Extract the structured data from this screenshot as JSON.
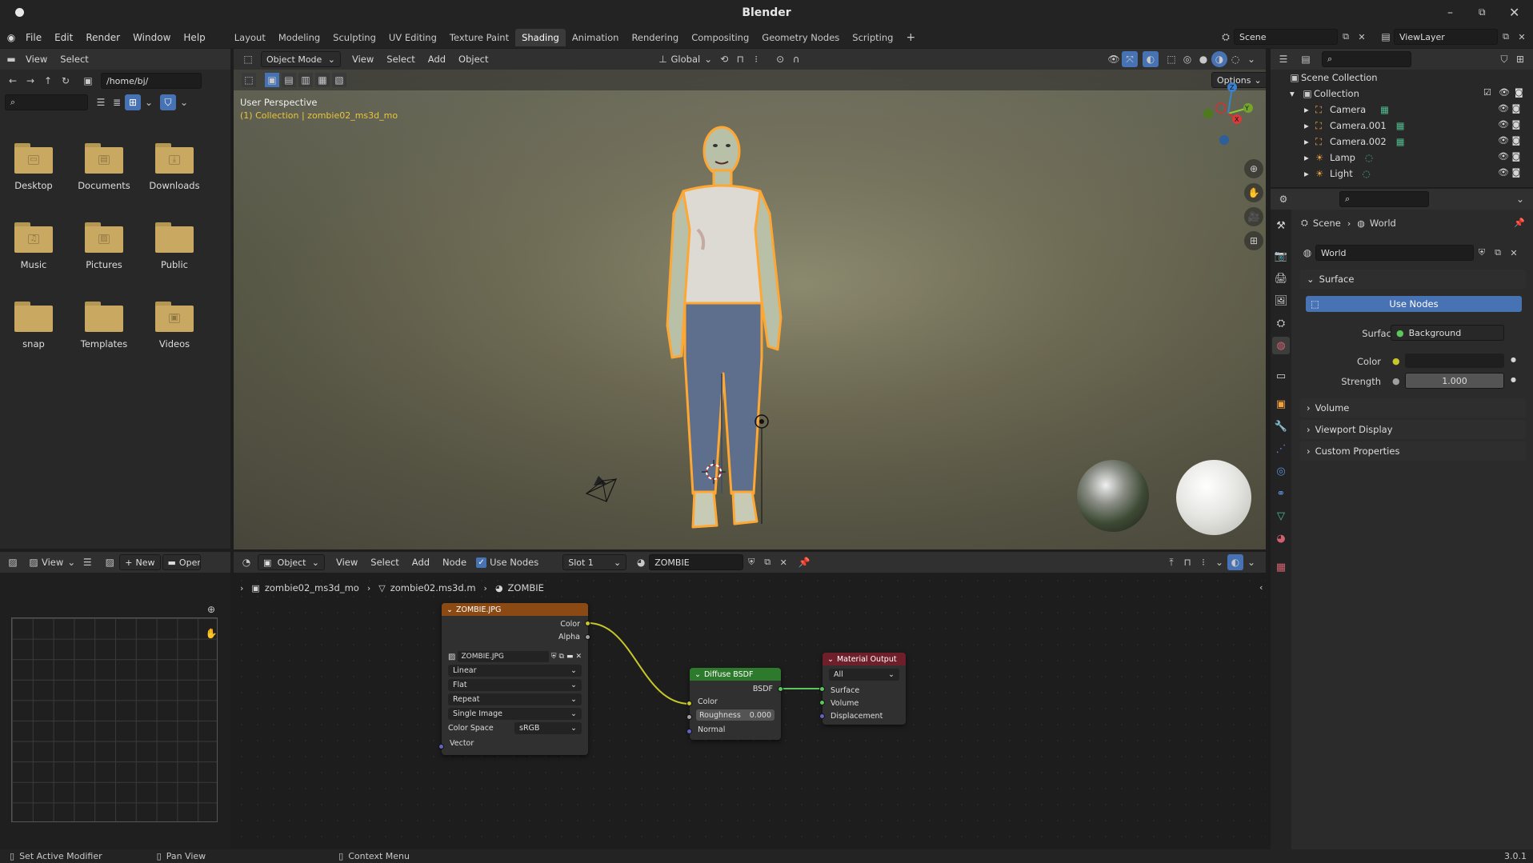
{
  "app": {
    "title": "Blender",
    "version": "3.0.1"
  },
  "menu": [
    "File",
    "Edit",
    "Render",
    "Window",
    "Help"
  ],
  "workspaces": [
    "Layout",
    "Modeling",
    "Sculpting",
    "UV Editing",
    "Texture Paint",
    "Shading",
    "Animation",
    "Rendering",
    "Compositing",
    "Geometry Nodes",
    "Scripting"
  ],
  "active_workspace": "Shading",
  "scene_name": "Scene",
  "view_layer": "ViewLayer",
  "file_browser": {
    "menu": [
      "View",
      "Select"
    ],
    "path": "/home/bj/",
    "folders": [
      {
        "label": "Desktop",
        "glyph": "▭"
      },
      {
        "label": "Documents",
        "glyph": "▤"
      },
      {
        "label": "Downloads",
        "glyph": "⤓"
      },
      {
        "label": "Music",
        "glyph": "♫"
      },
      {
        "label": "Pictures",
        "glyph": "▨"
      },
      {
        "label": "Public",
        "glyph": ""
      },
      {
        "label": "snap",
        "glyph": ""
      },
      {
        "label": "Templates",
        "glyph": ""
      },
      {
        "label": "Videos",
        "glyph": "▣"
      }
    ]
  },
  "viewport": {
    "mode": "Object Mode",
    "menu": [
      "View",
      "Select",
      "Add",
      "Object"
    ],
    "orientation": "Global",
    "options_label": "Options",
    "overlay_title": "User Perspective",
    "overlay_sub": "(1) Collection | zombie02_ms3d_mo"
  },
  "outliner": {
    "root": "Scene Collection",
    "collection": "Collection",
    "items": [
      "Camera",
      "Camera.001",
      "Camera.002",
      "Lamp",
      "Light"
    ]
  },
  "properties": {
    "breadcrumb": [
      "Scene",
      "World"
    ],
    "world_name": "World",
    "surface_section": "Surface",
    "use_nodes_label": "Use Nodes",
    "surface_label": "Surface",
    "surface_value": "Background",
    "color_label": "Color",
    "strength_label": "Strength",
    "strength_value": "1.000",
    "collapsed_sections": [
      "Volume",
      "Viewport Display",
      "Custom Properties"
    ]
  },
  "image_editor": {
    "view_label": "View",
    "new_label": "New",
    "open_label": "Open"
  },
  "node_editor": {
    "object_type": "Object",
    "menu": [
      "View",
      "Select",
      "Add",
      "Node"
    ],
    "use_nodes_label": "Use Nodes",
    "slot": "Slot 1",
    "material": "ZOMBIE",
    "breadcrumb": [
      "zombie02_ms3d_mo",
      "zombie02.ms3d.m",
      "ZOMBIE"
    ],
    "image_node": {
      "title": "ZOMBIE.JPG",
      "out_color": "Color",
      "out_alpha": "Alpha",
      "image_name": "ZOMBIE.JPG",
      "interpolation": "Linear",
      "projection": "Flat",
      "extension": "Repeat",
      "source": "Single Image",
      "color_space_label": "Color Space",
      "color_space": "sRGB",
      "in_vector": "Vector"
    },
    "diffuse_node": {
      "title": "Diffuse BSDF",
      "out_bsdf": "BSDF",
      "in_color": "Color",
      "roughness_label": "Roughness",
      "roughness_value": "0.000",
      "in_normal": "Normal"
    },
    "output_node": {
      "title": "Material Output",
      "target": "All",
      "in_surface": "Surface",
      "in_volume": "Volume",
      "in_displacement": "Displacement"
    }
  },
  "status_bar": {
    "left": "Set Active Modifier",
    "middle": "Pan View",
    "right": "Context Menu"
  },
  "colors": {
    "selection_orange": "#ffa733",
    "image_node_header": "#8b4a14",
    "shader_node_header": "#2d7a2d",
    "output_node_header": "#6e1f2a",
    "use_nodes_blue": "#4772b3",
    "link_yellow": "#c7c729",
    "link_green": "#5bc75b"
  }
}
